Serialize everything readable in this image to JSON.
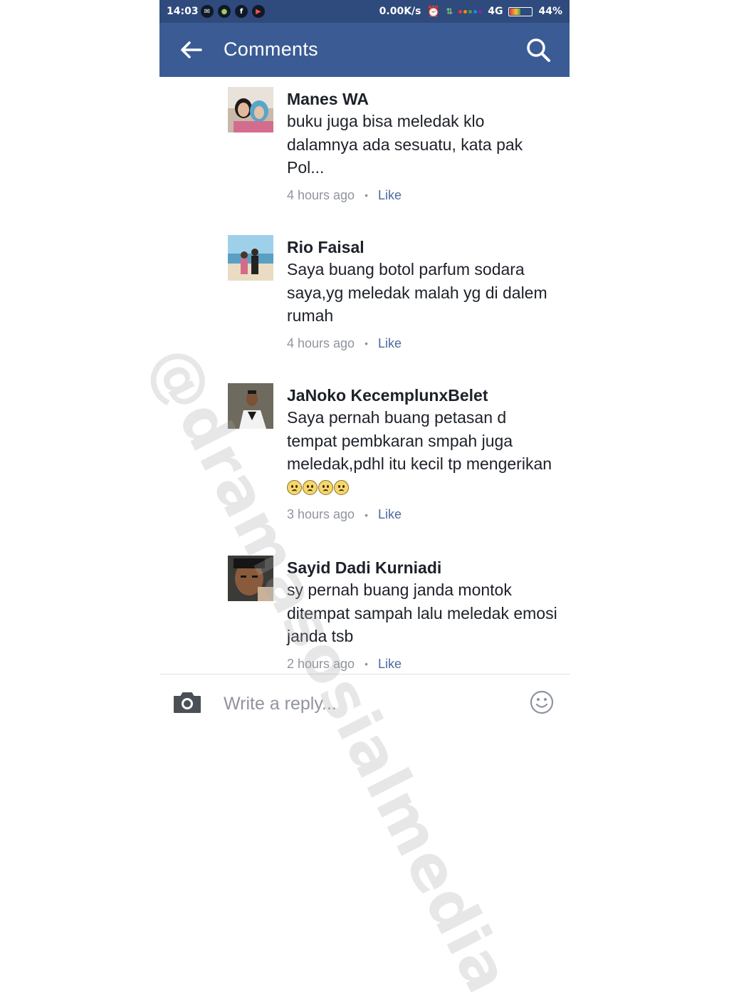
{
  "status_bar": {
    "time": "14:03",
    "net_speed": "0.00K/s",
    "network_type": "4G",
    "battery": "44%",
    "battery_level": 0.44,
    "app_icons": [
      "messenger-icon",
      "android-icon",
      "facebook-icon",
      "youtube-icon"
    ]
  },
  "header": {
    "title": "Comments",
    "back_icon": "arrow-left-icon",
    "search_icon": "search-icon",
    "background_color": "#3b5b94"
  },
  "comments": [
    {
      "author": "Manes WA",
      "text": "buku juga bisa meledak klo dalamnya ada sesuatu, kata pak Pol...",
      "time": "4 hours ago",
      "like_label": "Like"
    },
    {
      "author": "Rio Faisal",
      "text": "Saya buang botol parfum sodara saya,yg meledak malah yg di dalem rumah",
      "time": "4 hours ago",
      "like_label": "Like"
    },
    {
      "author": "JaNoko KecemplunxBelet",
      "text": "Saya pernah buang petasan d tempat pembkaran smpah juga meledak,pdhl itu kecil tp mengerikan",
      "emoji_count": 4,
      "time": "3 hours ago",
      "like_label": "Like"
    },
    {
      "author": "Sayid Dadi Kurniadi",
      "text": "sy pernah buang janda montok ditempat sampah lalu meledak emosi janda tsb",
      "time": "2 hours ago",
      "like_label": "Like"
    }
  ],
  "meta_separator": "•",
  "watermark": "@dramasosialmedia",
  "reply_bar": {
    "placeholder": "Write a reply...",
    "camera_icon": "camera-icon",
    "emoji_icon": "smiley-icon"
  },
  "colors": {
    "status_bar": "#2f4a7c",
    "link": "#4b6aa0",
    "meta_text": "#90949c",
    "body_text": "#1d2129"
  }
}
